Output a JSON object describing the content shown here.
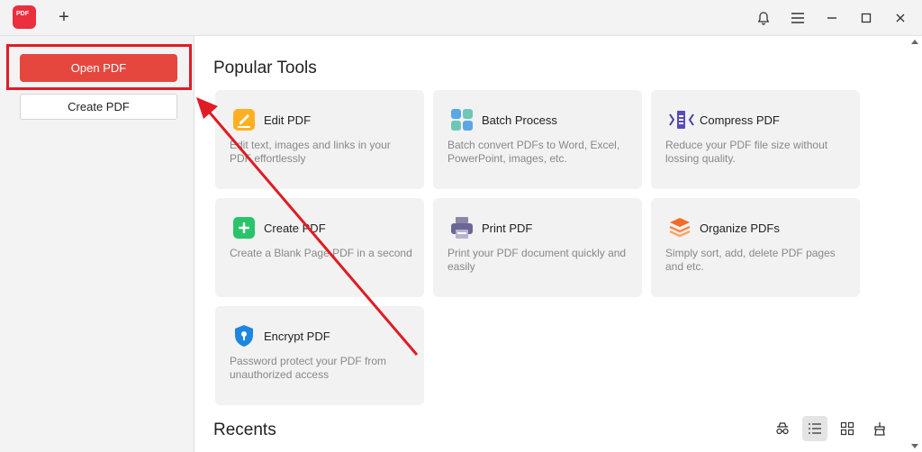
{
  "titlebar": {
    "logo_text": "PDF",
    "new_tab_icon": "plus-icon",
    "icons": [
      "bell-icon",
      "menu-icon",
      "minimize-icon",
      "maximize-icon",
      "close-icon"
    ]
  },
  "sidebar": {
    "open_label": "Open PDF",
    "create_label": "Create PDF"
  },
  "main": {
    "popular_title": "Popular Tools",
    "recents_title": "Recents",
    "tools": [
      {
        "name": "Edit PDF",
        "desc": "Edit text, images and links in your PDF effortlessly",
        "icon": "edit-pdf-icon"
      },
      {
        "name": "Batch Process",
        "desc": "Batch convert PDFs to Word, Excel, PowerPoint, images, etc.",
        "icon": "batch-process-icon"
      },
      {
        "name": "Compress PDF",
        "desc": "Reduce your PDF file size without lossing quality.",
        "icon": "compress-pdf-icon"
      },
      {
        "name": "Create PDF",
        "desc": "Create a Blank Page PDF in a second",
        "icon": "create-pdf-icon"
      },
      {
        "name": "Print PDF",
        "desc": "Print your PDF document quickly and easily",
        "icon": "print-pdf-icon"
      },
      {
        "name": "Organize PDFs",
        "desc": "Simply sort, add, delete PDF pages and etc.",
        "icon": "organize-pdfs-icon"
      },
      {
        "name": "Encrypt PDF",
        "desc": "Password protect your PDF from unauthorized access",
        "icon": "encrypt-pdf-icon"
      }
    ],
    "view_icons": [
      "incognito-icon",
      "list-view-icon",
      "grid-view-icon",
      "cleanup-icon"
    ]
  },
  "colors": {
    "accent": "#e5473f",
    "highlight": "#e11b24",
    "card_bg": "#f2f2f2"
  }
}
